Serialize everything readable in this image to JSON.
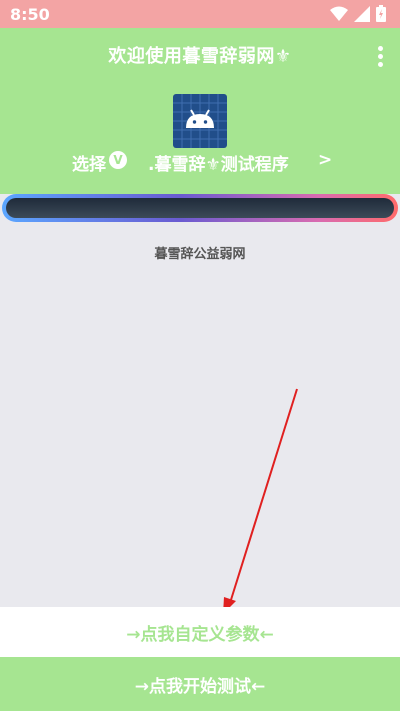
{
  "status_bar": {
    "time": "8:50",
    "icons": [
      "wifi-icon",
      "signal-icon",
      "battery-icon"
    ]
  },
  "header": {
    "title": "欢迎使用暮雪辞弱网⚜",
    "subtitle_left": "选择",
    "subtitle_badge": "V",
    "subtitle_right": ".暮雪辞⚜测试程序",
    "subtitle_chevron": ">"
  },
  "notice": "暮雪辞公益弱网",
  "buttons": {
    "custom_params": "→点我自定义参数←",
    "start_test": "→点我开始测试←"
  },
  "colors": {
    "accent": "#a6e591",
    "status_bar": "#f3a4a4",
    "arrow": "#e02020"
  }
}
